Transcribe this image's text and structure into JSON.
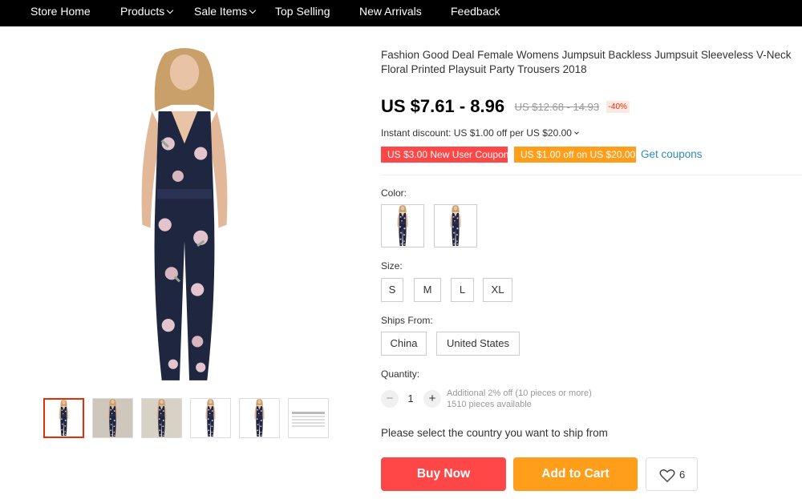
{
  "nav": {
    "items": [
      {
        "label": "Store Home"
      },
      {
        "label": "Products"
      },
      {
        "label": "Sale Items"
      },
      {
        "label": "Top Selling"
      },
      {
        "label": "New Arrivals"
      },
      {
        "label": "Feedback"
      }
    ]
  },
  "product": {
    "title": "Fashion Good Deal Female Womens Jumpsuit Backless Jumpsuit Sleeveless V-Neck Floral Printed Playsuit Party Trousers 2018",
    "price": "US $7.61 - 8.96",
    "original_price": "US $12.68 - 14.93",
    "discount": "-40%",
    "instant_discount": "Instant discount: US $1.00 off per US $20.00"
  },
  "coupons": {
    "new_user": "US $3.00 New User Coupon",
    "store": "US $1.00 off on US $20.00",
    "get_link": "Get coupons"
  },
  "options": {
    "color_label": "Color:",
    "size_label": "Size:",
    "sizes": [
      "S",
      "M",
      "L",
      "XL"
    ],
    "ships_label": "Ships From:",
    "ships": [
      "China",
      "United States"
    ]
  },
  "quantity": {
    "label": "Quantity:",
    "minus": "−",
    "value": "1",
    "plus": "+",
    "additional": "Additional 2% off (10 pieces or more)",
    "available": "1510 pieces available"
  },
  "ship_message": "Please select the country you want to ship from",
  "actions": {
    "buy_now": "Buy Now",
    "add_to_cart": "Add to Cart",
    "wishlist_count": "6"
  },
  "colors": {
    "accent_red": "#ff4747",
    "accent_orange": "#ff9e1a",
    "link_blue": "#2f8ab8",
    "outfit_navy": "#1f2640",
    "flower_pink": "#e3c4cc"
  }
}
